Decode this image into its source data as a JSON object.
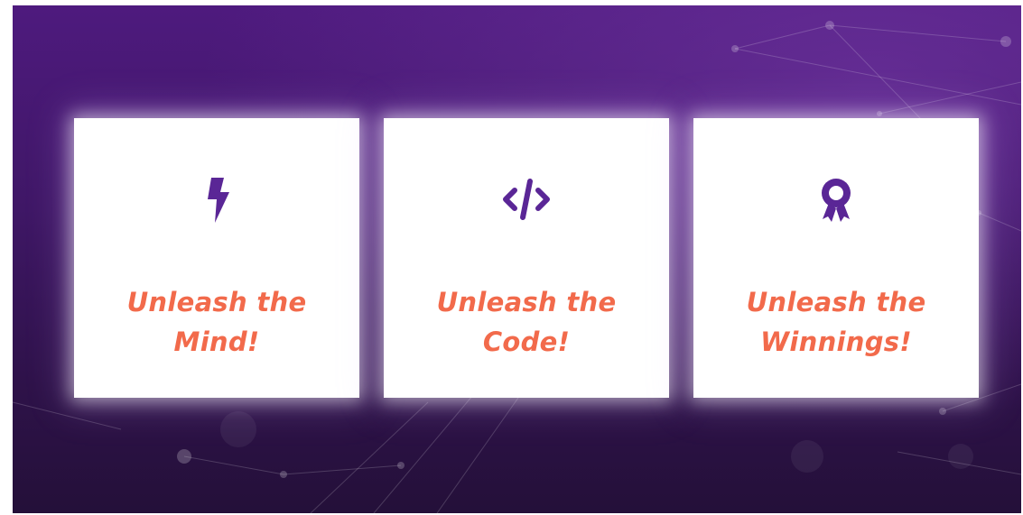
{
  "colors": {
    "background_top": "#4e1a7e",
    "background_bottom": "#241039",
    "card": "#ffffff",
    "icon": "#5a2696",
    "title": "#f26a4b"
  },
  "cards": [
    {
      "icon": "lightning-bolt-icon",
      "title_line1": "Unleash the",
      "title_line2": "Mind!"
    },
    {
      "icon": "code-brackets-icon",
      "title_line1": "Unleash the",
      "title_line2": "Code!"
    },
    {
      "icon": "award-ribbon-icon",
      "title_line1": "Unleash the",
      "title_line2": "Winnings!"
    }
  ]
}
